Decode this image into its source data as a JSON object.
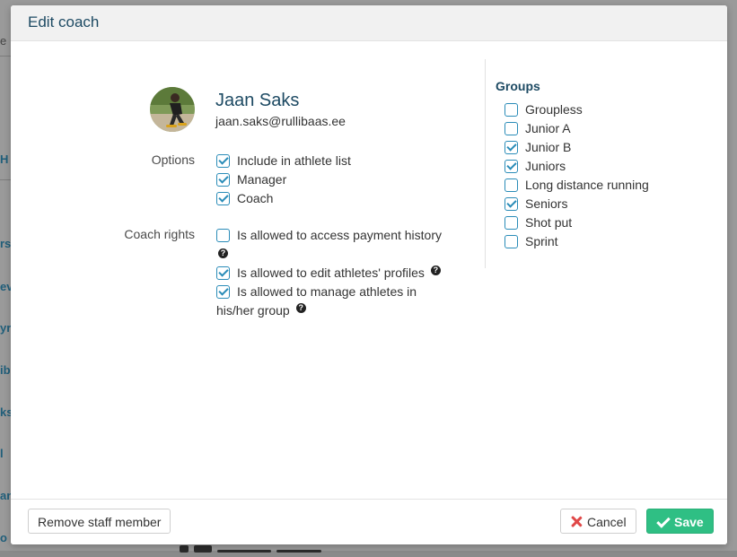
{
  "background": {
    "fragments": [
      "e",
      "H",
      "rs",
      "ev",
      "yr",
      "ib",
      "ks",
      "l",
      "an",
      "o"
    ]
  },
  "modal": {
    "title": "Edit coach",
    "user": {
      "name": "Jaan Saks",
      "email": "jaan.saks@rullibaas.ee"
    },
    "options": {
      "label": "Options",
      "items": [
        {
          "label": "Include in athlete list",
          "checked": true
        },
        {
          "label": "Manager",
          "checked": true
        },
        {
          "label": "Coach",
          "checked": true
        }
      ]
    },
    "coach_rights": {
      "label": "Coach rights",
      "items": [
        {
          "label": "Is allowed to access payment history",
          "checked": false
        },
        {
          "label": "Is allowed to edit athletes' profiles",
          "checked": true
        },
        {
          "label_line1": "Is allowed to manage athletes in",
          "label_line2": "his/her group",
          "checked": true
        }
      ]
    },
    "groups": {
      "title": "Groups",
      "items": [
        {
          "label": "Groupless",
          "checked": false
        },
        {
          "label": "Junior A",
          "checked": false
        },
        {
          "label": "Junior B",
          "checked": true
        },
        {
          "label": "Juniors",
          "checked": true
        },
        {
          "label": "Long distance running",
          "checked": false
        },
        {
          "label": "Seniors",
          "checked": true
        },
        {
          "label": "Shot put",
          "checked": false
        },
        {
          "label": "Sprint",
          "checked": false
        }
      ]
    },
    "footer": {
      "remove_label": "Remove staff member",
      "cancel_label": "Cancel",
      "save_label": "Save"
    }
  },
  "colors": {
    "accent": "#2a8cb8",
    "save": "#2fbf84",
    "cancel_icon": "#e04848",
    "title": "#1d4a63"
  }
}
